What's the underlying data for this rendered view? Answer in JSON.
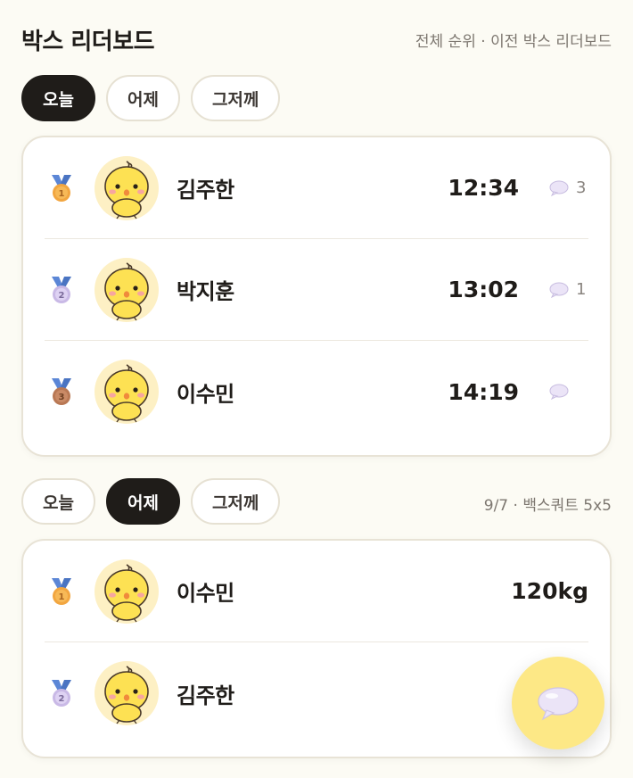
{
  "header": {
    "title": "박스 리더보드",
    "link_all": "전체 순위",
    "separator": " · ",
    "link_prev": "이전 박스 리더보드"
  },
  "section1": {
    "tabs": [
      {
        "label": "오늘",
        "active": true
      },
      {
        "label": "어제",
        "active": false
      },
      {
        "label": "그저께",
        "active": false
      }
    ],
    "rows": [
      {
        "rank": "1",
        "name": "김주한",
        "score": "12:34",
        "comments": "3"
      },
      {
        "rank": "2",
        "name": "박지훈",
        "score": "13:02",
        "comments": "1"
      },
      {
        "rank": "3",
        "name": "이수민",
        "score": "14:19",
        "comments": ""
      }
    ]
  },
  "section2": {
    "tabs": [
      {
        "label": "오늘",
        "active": false
      },
      {
        "label": "어제",
        "active": true
      },
      {
        "label": "그저께",
        "active": false
      }
    ],
    "meta": "9/7 · 백스쿼트 5x5",
    "rows": [
      {
        "rank": "1",
        "name": "이수민",
        "score": "120kg"
      },
      {
        "rank": "2",
        "name": "김주한",
        "score": ""
      }
    ]
  },
  "colors": {
    "background": "#fcfbf4",
    "active_tab": "#1f1c19",
    "gold": "#f2a640",
    "silver": "#d9ccee",
    "bronze": "#b97854",
    "ribbon": "#5b86d6",
    "fab": "#fde886"
  },
  "icons": {
    "medal": "medal-icon",
    "comment": "speech-bubble-icon",
    "avatar": "chick-avatar"
  }
}
